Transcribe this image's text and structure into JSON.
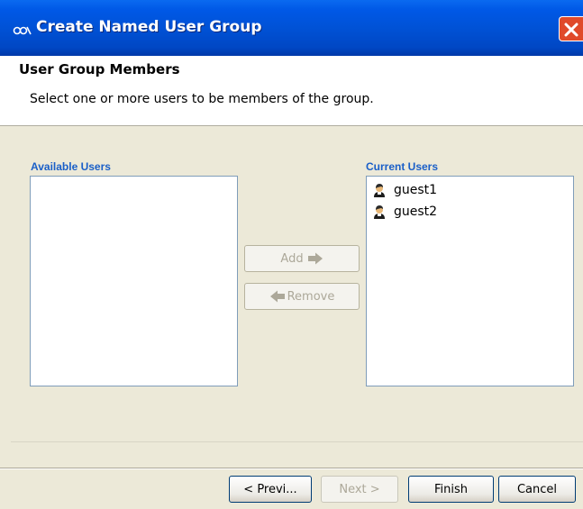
{
  "window": {
    "title": "Create Named User Group",
    "icon": "app-logo-icon"
  },
  "header": {
    "title": "User Group Members",
    "description": "Select one or more users to be members of the group."
  },
  "available": {
    "label": "Available Users",
    "items": []
  },
  "current": {
    "label": "Current Users",
    "items": [
      {
        "name": "guest1",
        "icon": "user-icon"
      },
      {
        "name": "guest2",
        "icon": "user-icon"
      }
    ]
  },
  "actions": {
    "add_label": "Add",
    "remove_label": "Remove"
  },
  "footer": {
    "previous_label": "< Previ...",
    "next_label": "Next >",
    "finish_label": "Finish",
    "cancel_label": "Cancel"
  },
  "colors": {
    "titlebar": "#0052d6",
    "label_blue": "#1a5fc8",
    "close_red": "#e04a2a"
  }
}
